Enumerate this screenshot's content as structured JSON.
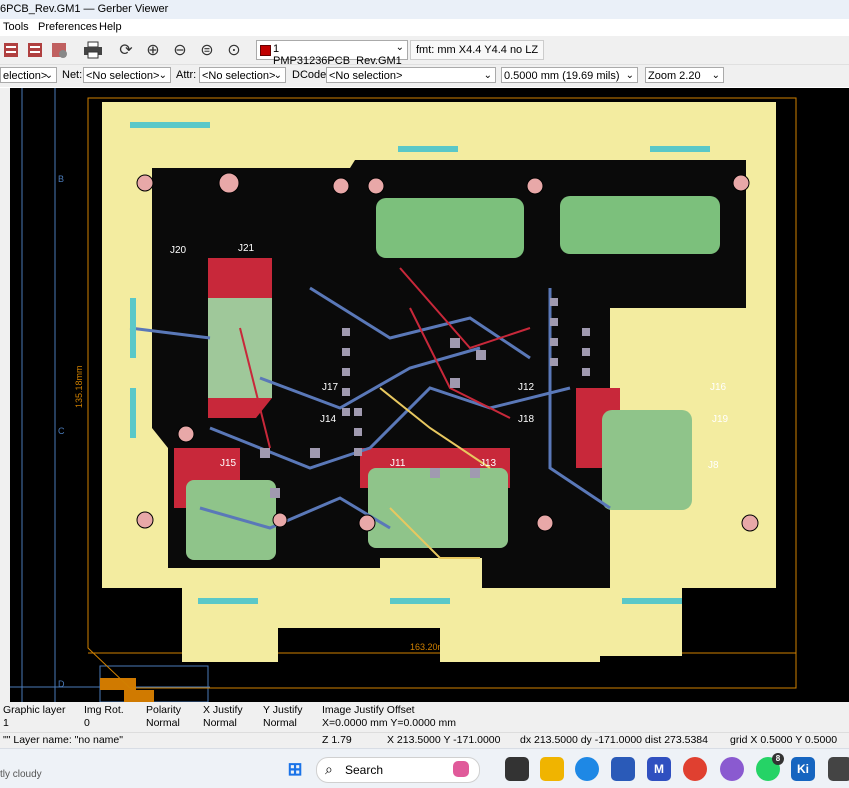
{
  "window": {
    "title": "6PCB_Rev.GM1 — Gerber Viewer"
  },
  "menu": {
    "items": [
      "Tools",
      "Preferences",
      "Help"
    ]
  },
  "toolbar": {
    "layer_select": "1 PMP31236PCB_Rev.GM1",
    "format": "fmt: mm X4.4 Y4.4 no LZ"
  },
  "filters": {
    "component_value": "election>",
    "net_label": "Net:",
    "net_value": "<No selection>",
    "attr_label": "Attr:",
    "attr_value": "<No selection>",
    "dcode_label": "DCode:",
    "dcode_value": "<No selection>",
    "line_width": "0.5000 mm (19.69 mils)",
    "zoom": "Zoom 2.20"
  },
  "canvas": {
    "ruler_letters": [
      "B",
      "C",
      "D"
    ],
    "dimension_vertical": "135.18mm",
    "dimension_horizontal": "163.20mm",
    "labels": [
      "J20",
      "J21",
      "J17",
      "J14",
      "J12",
      "J18",
      "J13",
      "J16",
      "J19",
      "J15",
      "J8",
      "J11"
    ]
  },
  "info_panel": {
    "headers": [
      "Graphic layer",
      "Img Rot.",
      "Polarity",
      "X Justify",
      "Y Justify",
      "Image Justify Offset"
    ],
    "values": [
      "1",
      "0",
      "Normal",
      "Normal",
      "Normal",
      "X=0.0000 mm Y=0.0000 mm"
    ]
  },
  "statusbar": {
    "layer_name": "\"\"  Layer name: \"no name\"",
    "z": "Z 1.79",
    "xy": "X 213.5000  Y -171.0000",
    "delta": "dx 213.5000  dy -171.0000  dist 273.5384",
    "grid": "grid X 0.5000  Y 0.5000"
  },
  "taskbar": {
    "weather": "tly cloudy",
    "search_placeholder": "Search",
    "badge": "8",
    "ki_label": "Ki"
  },
  "colors": {
    "board_yellow": "#f3eca0",
    "copper_red": "#c8283a",
    "trace_blue": "#5a78b8",
    "pad_grey": "#a09ab0",
    "ruler_orange": "#d08000"
  }
}
